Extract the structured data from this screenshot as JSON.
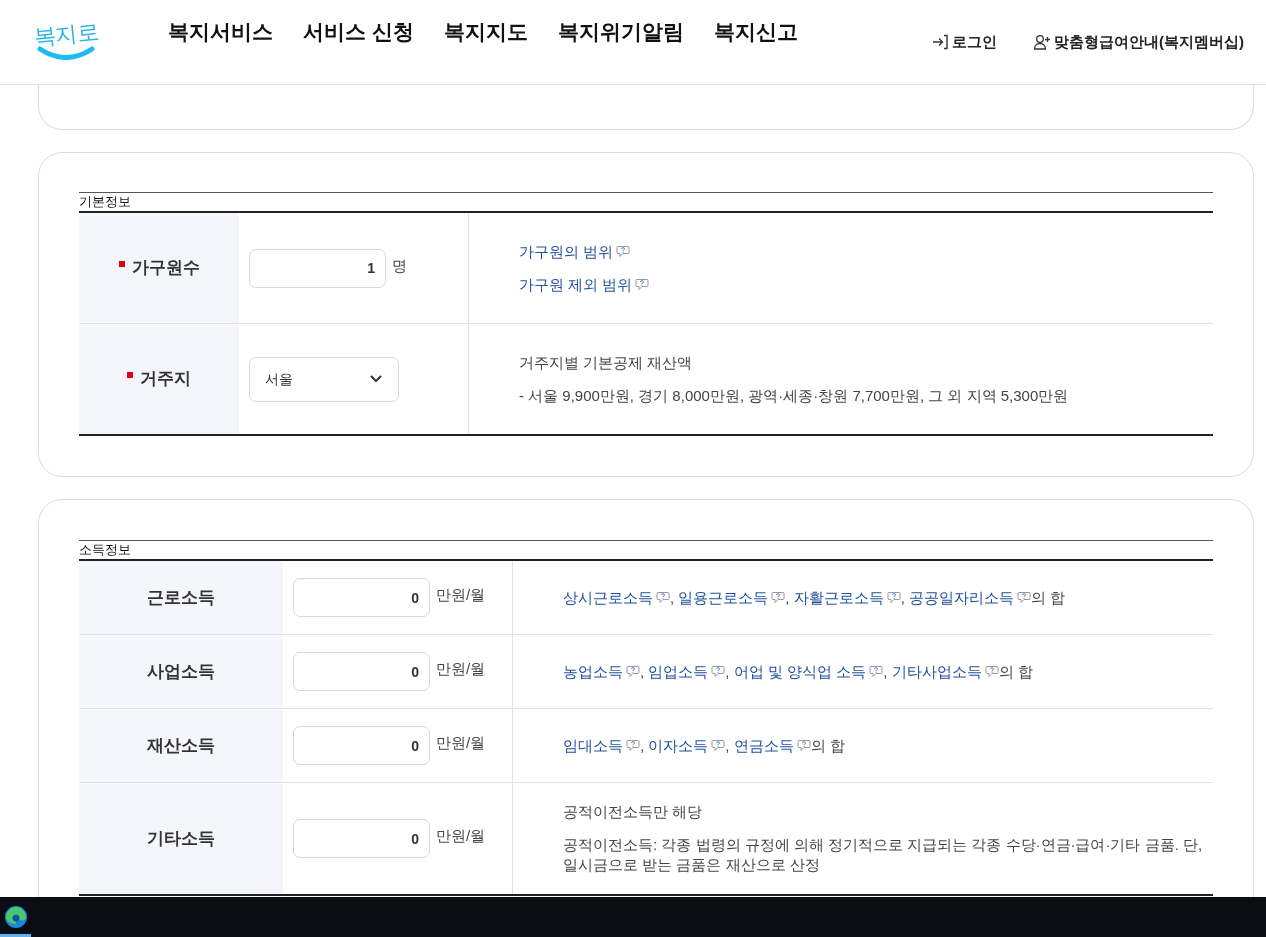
{
  "header": {
    "logo": "복지로",
    "nav": [
      {
        "label": "복지서비스"
      },
      {
        "label": "서비스 신청"
      },
      {
        "label": "복지지도"
      },
      {
        "label": "복지위기알림"
      },
      {
        "label": "복지신고"
      }
    ],
    "utility": [
      {
        "label": "로그인",
        "kind": "login"
      },
      {
        "label": "맞춤형급여안내(복지멤버십)",
        "kind": "member"
      }
    ]
  },
  "basic_info": {
    "title": "기본정보",
    "rows": [
      {
        "label": "가구원수",
        "required": true,
        "kind": "input",
        "value": "1",
        "unit": "명",
        "lines": [
          [
            {
              "text": "가구원의 범위",
              "kind": "link",
              "help": true
            }
          ],
          [
            {
              "text": "가구원 제외 범위",
              "kind": "link",
              "help": true
            }
          ]
        ]
      },
      {
        "label": "거주지",
        "required": true,
        "kind": "select",
        "value": "서울",
        "lines": [
          [
            {
              "text": "거주지별 기본공제 재산액",
              "kind": "plain"
            }
          ],
          [
            {
              "text": "- 서울 9,900만원, 경기 8,000만원, 광역·세종·창원 7,700만원, 그 외 지역 5,300만원",
              "kind": "plain"
            }
          ]
        ]
      }
    ]
  },
  "income_info": {
    "title": "소득정보",
    "rows": [
      {
        "label": "근로소득",
        "required": false,
        "kind": "input",
        "value": "0",
        "unit": "만원/월",
        "lines": [
          [
            {
              "text": "상시근로소득",
              "kind": "link",
              "help": true,
              "after": ", "
            },
            {
              "text": "일용근로소득",
              "kind": "link",
              "help": true,
              "after": ", "
            },
            {
              "text": "자활근로소득",
              "kind": "link",
              "help": true,
              "after": ", "
            },
            {
              "text": "공공일자리소득",
              "kind": "link",
              "help": true,
              "after": "의 합"
            }
          ]
        ]
      },
      {
        "label": "사업소득",
        "required": false,
        "kind": "input",
        "value": "0",
        "unit": "만원/월",
        "lines": [
          [
            {
              "text": "농업소득",
              "kind": "link",
              "help": true,
              "after": ", "
            },
            {
              "text": "임업소득",
              "kind": "link",
              "help": true,
              "after": ", "
            },
            {
              "text": "어업 및 양식업 소득",
              "kind": "link",
              "help": true,
              "after": ", "
            },
            {
              "text": "기타사업소득",
              "kind": "link",
              "help": true,
              "after": "의 합"
            }
          ]
        ]
      },
      {
        "label": "재산소득",
        "required": false,
        "kind": "input",
        "value": "0",
        "unit": "만원/월",
        "lines": [
          [
            {
              "text": "임대소득",
              "kind": "link",
              "help": true,
              "after": ", "
            },
            {
              "text": "이자소득",
              "kind": "link",
              "help": true,
              "after": ", "
            },
            {
              "text": "연금소득",
              "kind": "link",
              "help": true,
              "after": "의 합"
            }
          ]
        ]
      },
      {
        "label": "기타소득",
        "required": false,
        "kind": "input",
        "value": "0",
        "unit": "만원/월",
        "lines": [
          [
            {
              "text": "공적이전소득만 해당",
              "kind": "plain"
            }
          ],
          [
            {
              "text": "공적이전소득: 각종 법령의 규정에 의해 정기적으로 지급되는 각종 수당·연금·급여·기타 금품. 단, 일시금으로 받는 금품은 재산으로 산정",
              "kind": "plain"
            }
          ]
        ]
      }
    ]
  }
}
